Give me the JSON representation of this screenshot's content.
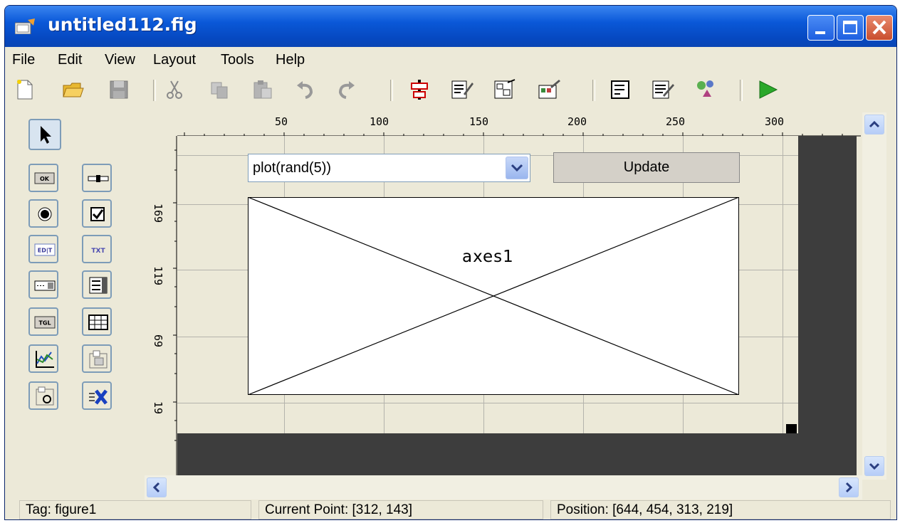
{
  "window": {
    "title": "untitled112.fig"
  },
  "menu": [
    "File",
    "Edit",
    "View",
    "Layout",
    "Tools",
    "Help"
  ],
  "toolbar": {
    "icons": [
      "new-file-icon",
      "open-folder-icon",
      "save-icon",
      "cut-icon",
      "copy-icon",
      "paste-icon",
      "undo-icon",
      "redo-icon",
      "align-objects-icon",
      "menu-editor-icon",
      "tab-order-editor-icon",
      "toolbar-editor-icon",
      "editor-icon",
      "property-inspector-icon",
      "object-browser-icon",
      "run-icon"
    ]
  },
  "palette": {
    "icons": [
      "select-arrow-icon",
      "push-button-icon",
      "slider-icon",
      "radio-button-icon",
      "checkbox-icon",
      "edit-text-icon",
      "static-text-icon",
      "popup-menu-icon",
      "listbox-icon",
      "toggle-button-icon",
      "table-icon",
      "axes-icon",
      "panel-icon",
      "button-group-icon",
      "activex-control-icon"
    ],
    "labels": {
      "ok": "OK",
      "edit": "ED|T",
      "txt": "TXT",
      "tgl": "TGL"
    }
  },
  "rulers": {
    "top": [
      "50",
      "100",
      "150",
      "200",
      "250",
      "300"
    ],
    "left": [
      "169",
      "119",
      "69",
      "19"
    ]
  },
  "figure": {
    "popup_value": "plot(rand(5))",
    "update_label": "Update",
    "axes_label": "axes1"
  },
  "status": {
    "tag": "Tag: figure1",
    "current_point": "Current Point:  [312, 143]",
    "position": "Position: [644, 454, 313, 219]"
  },
  "colors": {
    "title_bar": "#0a58d8",
    "canvas_dark": "#3d3d3d",
    "chrome": "#ece9d8"
  }
}
